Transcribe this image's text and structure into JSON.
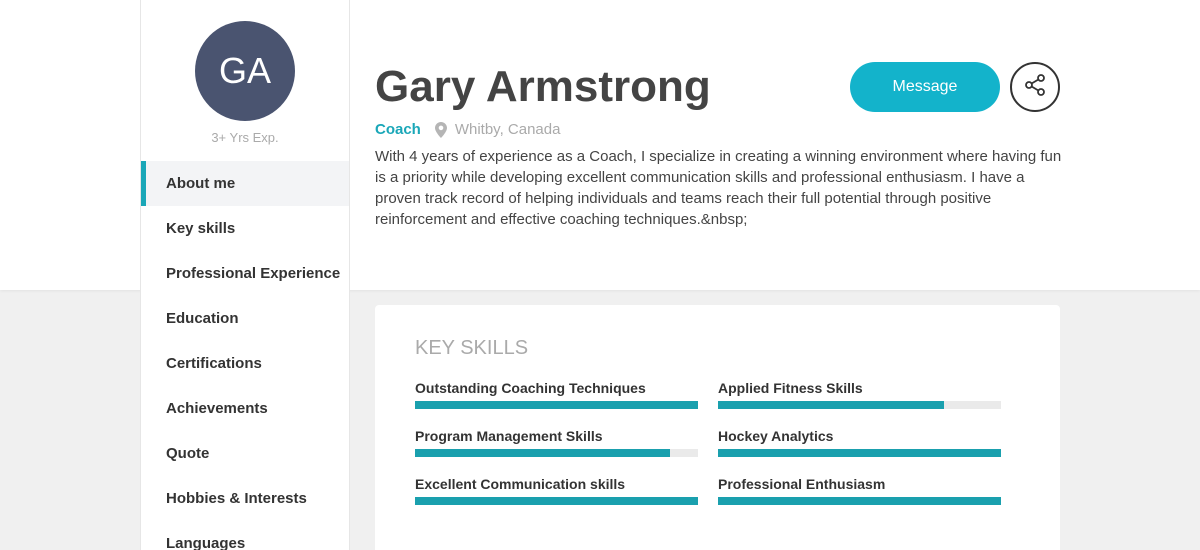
{
  "profile": {
    "initials": "GA",
    "experience": "3+ Yrs Exp.",
    "name": "Gary Armstrong",
    "title": "Coach",
    "location": "Whitby, Canada",
    "about": "With 4 years of experience as a Coach, I specialize in creating a winning environment where having fun is a priority while developing excellent communication skills and professional enthusiasm. I have a proven track record of helping individuals and teams reach their full potential through positive reinforcement and effective coaching techniques.&nbsp;"
  },
  "actions": {
    "message_label": "Message",
    "share_icon": "share-icon"
  },
  "nav": {
    "items": [
      {
        "label": "About me",
        "active": true
      },
      {
        "label": "Key skills"
      },
      {
        "label": "Professional Experience"
      },
      {
        "label": "Education"
      },
      {
        "label": "Certifications"
      },
      {
        "label": "Achievements"
      },
      {
        "label": "Quote"
      },
      {
        "label": "Hobbies & Interests"
      },
      {
        "label": "Languages"
      }
    ]
  },
  "skills": {
    "heading": "KEY SKILLS",
    "items": [
      {
        "name": "Outstanding Coaching Techniques",
        "level": 1.0
      },
      {
        "name": "Applied Fitness Skills",
        "level": 0.8
      },
      {
        "name": "Program Management Skills",
        "level": 0.9
      },
      {
        "name": "Hockey Analytics",
        "level": 1.0
      },
      {
        "name": "Excellent Communication skills",
        "level": 1.0
      },
      {
        "name": "Professional Enthusiasm",
        "level": 1.0
      }
    ]
  },
  "colors": {
    "accent": "#1aa7b8",
    "avatar_bg": "#4a5470",
    "message_button": "#13b3cb"
  }
}
